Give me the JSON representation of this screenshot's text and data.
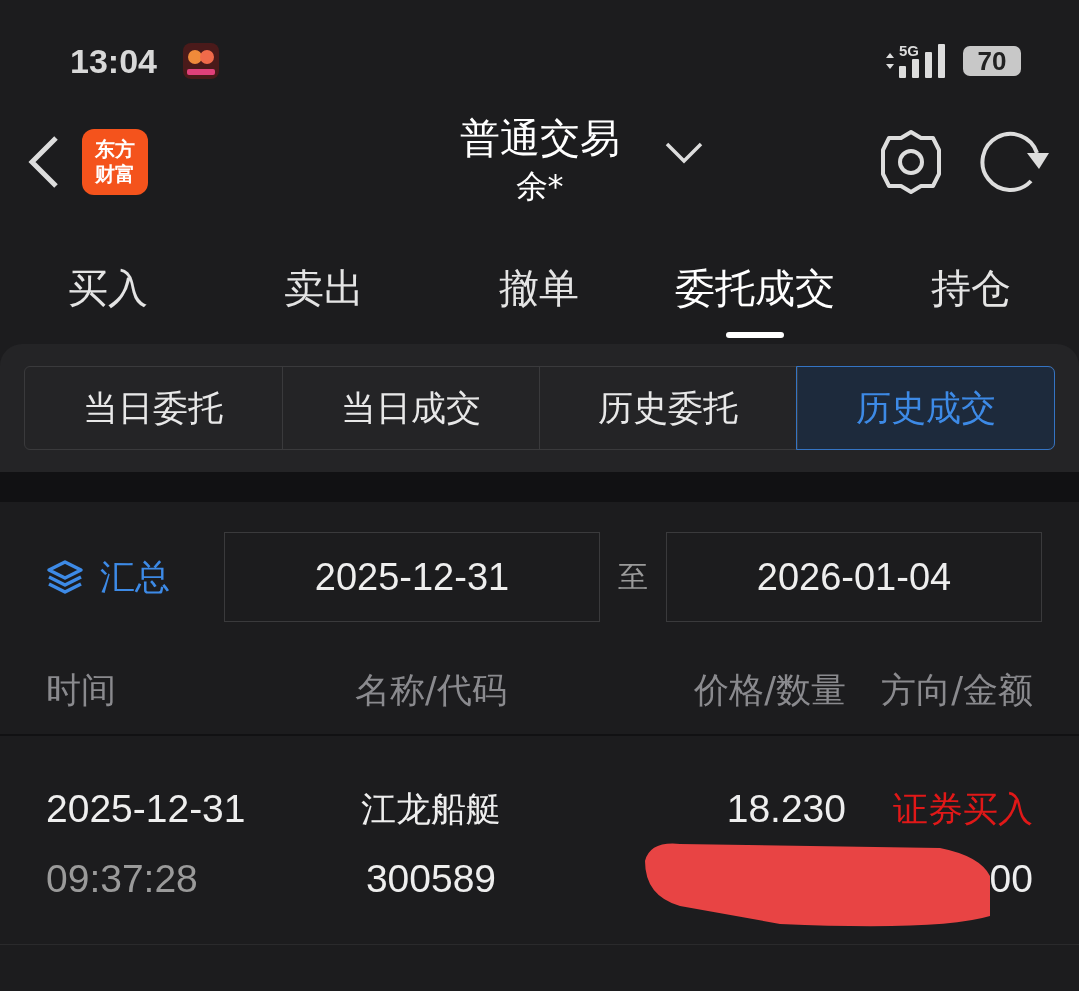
{
  "status_bar": {
    "time": "13:04",
    "network": "5G",
    "battery": "70"
  },
  "header": {
    "title": "普通交易",
    "account": "余*",
    "logo": "东方财富"
  },
  "tabs": [
    {
      "label": "买入",
      "selected": false
    },
    {
      "label": "卖出",
      "selected": false
    },
    {
      "label": "撤单",
      "selected": false
    },
    {
      "label": "委托成交",
      "selected": true
    },
    {
      "label": "持仓",
      "selected": false
    }
  ],
  "segments": [
    {
      "label": "当日委托",
      "selected": false
    },
    {
      "label": "当日成交",
      "selected": false
    },
    {
      "label": "历史委托",
      "selected": false
    },
    {
      "label": "历史成交",
      "selected": true
    }
  ],
  "filter": {
    "summary": "汇总",
    "start_date": "2025-12-31",
    "separator": "至",
    "end_date": "2026-01-04"
  },
  "table": {
    "columns": [
      "时间",
      "名称/代码",
      "价格/数量",
      "方向/金额"
    ],
    "rows": [
      {
        "date": "2025-12-31",
        "time": "09:37:28",
        "name": "江龙船艇",
        "code": "300589",
        "price": "18.230",
        "direction": "证券买入",
        "color": "#e01818",
        "amount": "00",
        "redacted": true
      }
    ]
  }
}
